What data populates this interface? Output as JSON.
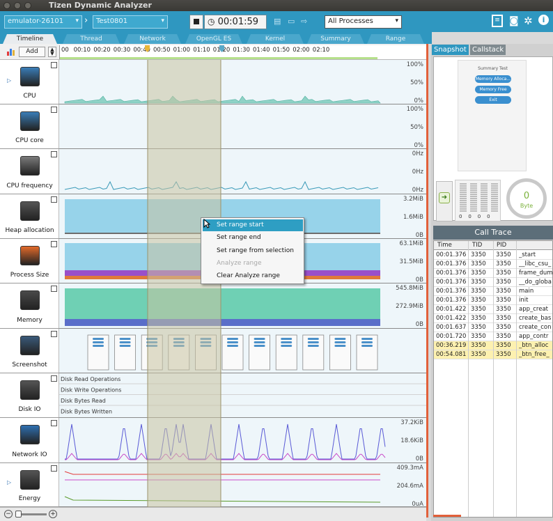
{
  "window": {
    "title": "Tizen Dynamic Analyzer"
  },
  "toolbar": {
    "device": "emulator-26101",
    "app": "Test0801",
    "timer": "00:01:59",
    "process_filter": "All Processes"
  },
  "tabs": [
    "Timeline",
    "Thread",
    "Network",
    "OpenGL ES",
    "Kernel",
    "Summary",
    "Range"
  ],
  "timeline": {
    "add_label": "Add",
    "ticks": [
      "00",
      "00:10",
      "00:20",
      "00:30",
      "00:40",
      "00:50",
      "01:00",
      "01:10",
      "01:20",
      "01:30",
      "01:40",
      "01:50",
      "02:00",
      "02:10"
    ]
  },
  "rows": [
    {
      "name": "CPU",
      "scale": [
        "100%",
        "50%",
        "0%"
      ]
    },
    {
      "name": "CPU core",
      "scale": [
        "100%",
        "50%",
        "0%"
      ]
    },
    {
      "name": "CPU frequency",
      "scale": [
        "0Hz",
        "0Hz",
        "0Hz"
      ]
    },
    {
      "name": "Heap allocation",
      "scale": [
        "3.2MiB",
        "1.6MiB",
        "0B"
      ]
    },
    {
      "name": "Process Size",
      "scale": [
        "63.1MiB",
        "31.5MiB",
        "0B"
      ]
    },
    {
      "name": "Memory",
      "scale": [
        "545.8MiB",
        "272.9MiB",
        "0B"
      ]
    },
    {
      "name": "Screenshot",
      "scale": []
    },
    {
      "name": "Disk IO",
      "scale": [],
      "sub": [
        "Disk Read Operations",
        "Disk Write Operations",
        "Disk Bytes Read",
        "Disk Bytes Written"
      ]
    },
    {
      "name": "Network IO",
      "scale": [
        "37.2KiB",
        "18.6KiB",
        "0B"
      ]
    },
    {
      "name": "Energy",
      "scale": [
        "409.3mA",
        "204.6mA",
        "0uA"
      ]
    }
  ],
  "context_menu": {
    "items": [
      {
        "label": "Set range start",
        "state": "selected"
      },
      {
        "label": "Set range end",
        "state": "normal"
      },
      {
        "label": "Set range from selection",
        "state": "normal"
      },
      {
        "label": "Analyze range",
        "state": "disabled"
      },
      {
        "label": "Clear Analyze range",
        "state": "normal"
      }
    ]
  },
  "right_panel": {
    "tabs": [
      "Snapshot",
      "Callstack"
    ],
    "snapshot": {
      "app_title": "Summary Test",
      "buttons": [
        "Memory Alloca...",
        "Memory Free",
        "Exit"
      ]
    },
    "mini_counts": [
      "0",
      "0",
      "0",
      "0"
    ],
    "gauge": {
      "value": "0",
      "unit": "Byte"
    },
    "call_trace": {
      "title": "Call Trace",
      "columns": [
        "Time",
        "TID",
        "PID",
        ""
      ],
      "rows": [
        {
          "time": "00:01.376",
          "tid": "3350",
          "pid": "3350",
          "name": "_start",
          "hl": false
        },
        {
          "time": "00:01.376",
          "tid": "3350",
          "pid": "3350",
          "name": "__libc_csu_",
          "hl": false
        },
        {
          "time": "00:01.376",
          "tid": "3350",
          "pid": "3350",
          "name": "frame_dum",
          "hl": false
        },
        {
          "time": "00:01.376",
          "tid": "3350",
          "pid": "3350",
          "name": "__do_globa",
          "hl": false
        },
        {
          "time": "00:01.376",
          "tid": "3350",
          "pid": "3350",
          "name": "main",
          "hl": false
        },
        {
          "time": "00:01.376",
          "tid": "3350",
          "pid": "3350",
          "name": "init",
          "hl": false
        },
        {
          "time": "00:01.422",
          "tid": "3350",
          "pid": "3350",
          "name": "app_creat",
          "hl": false
        },
        {
          "time": "00:01.422",
          "tid": "3350",
          "pid": "3350",
          "name": "create_bas",
          "hl": false
        },
        {
          "time": "00:01.637",
          "tid": "3350",
          "pid": "3350",
          "name": "create_con",
          "hl": false
        },
        {
          "time": "00:01.720",
          "tid": "3350",
          "pid": "3350",
          "name": "app_contr",
          "hl": false
        },
        {
          "time": "00:36.219",
          "tid": "3350",
          "pid": "3350",
          "name": "_btn_alloc",
          "hl": true
        },
        {
          "time": "00:54.081",
          "tid": "3350",
          "pid": "3350",
          "name": "_btn_free_",
          "hl": true
        }
      ]
    }
  },
  "colors": {
    "accent": "#2f97c0",
    "selection": "#c9c3a0",
    "splitter": "#e2603a"
  }
}
